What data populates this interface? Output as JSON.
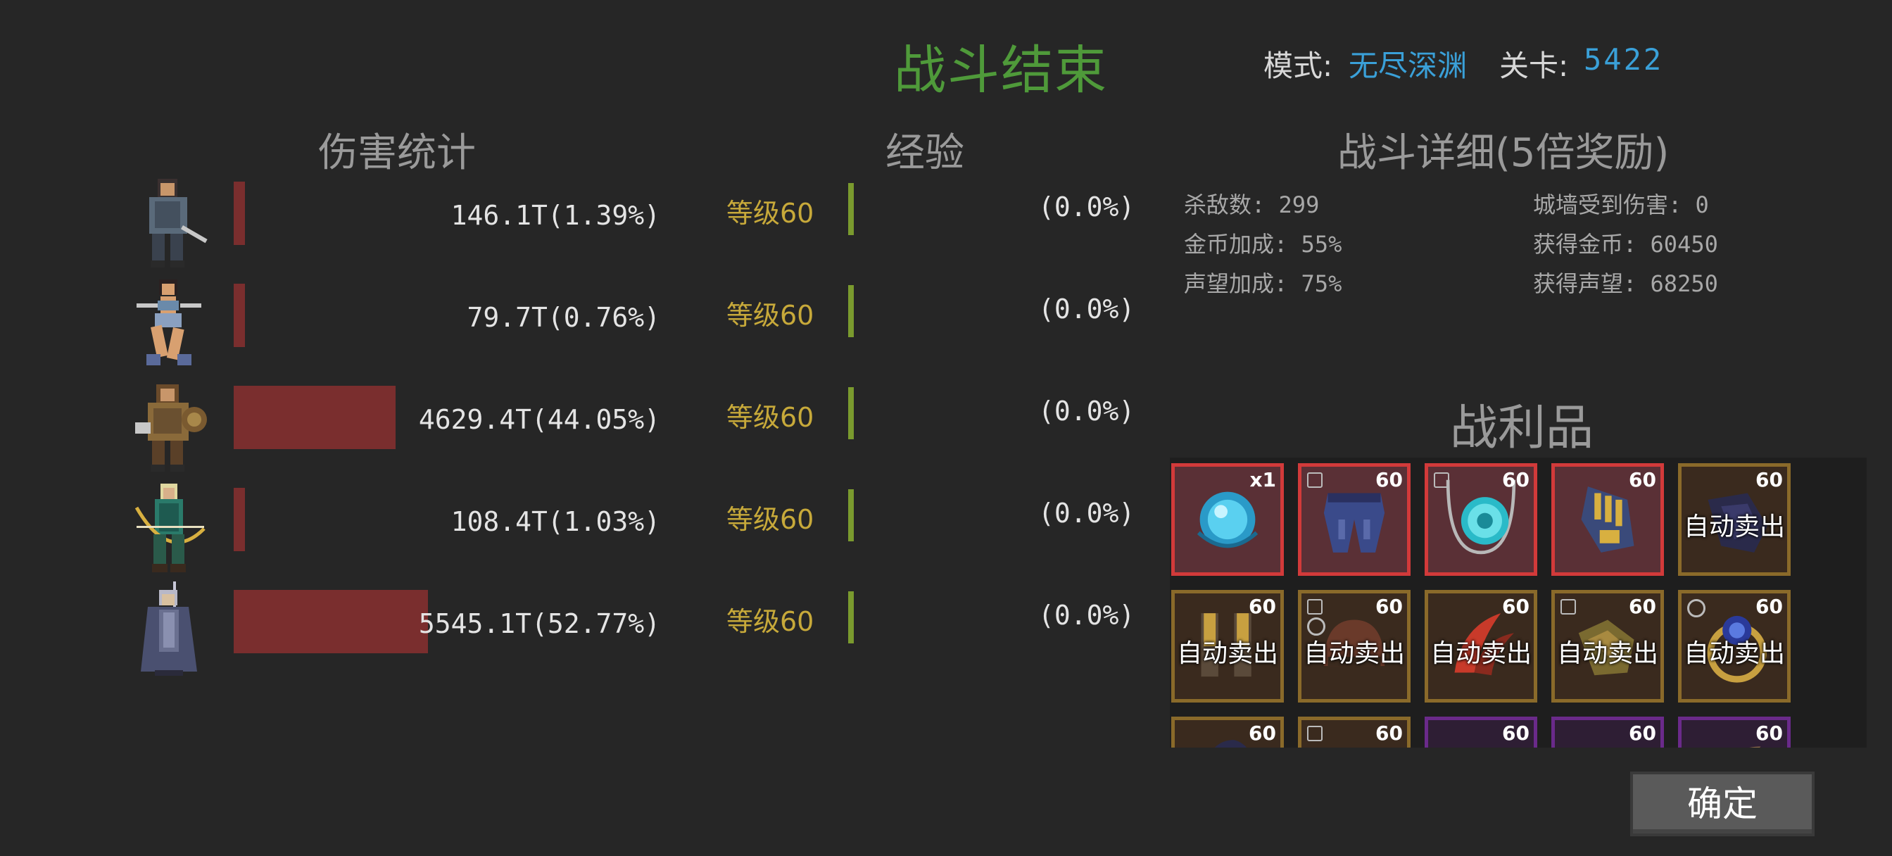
{
  "header": {
    "title": "战斗结束",
    "mode_label": "模式:",
    "mode_value": "无尽深渊",
    "stage_label": "关卡:",
    "stage_value": "5422"
  },
  "damage": {
    "title": "伤害统计",
    "rows": [
      {
        "hero": "swordsman-hero",
        "value": "146.1T(1.39%)",
        "share": 0.0139
      },
      {
        "hero": "dancer-hero",
        "value": "79.7T(0.76%)",
        "share": 0.0076
      },
      {
        "hero": "warrior-hero",
        "value": "4629.4T(44.05%)",
        "share": 0.4405
      },
      {
        "hero": "archer-hero",
        "value": "108.4T(1.03%)",
        "share": 0.0103
      },
      {
        "hero": "mage-hero",
        "value": "5545.1T(52.77%)",
        "share": 0.5277
      }
    ]
  },
  "experience": {
    "title": "经验",
    "rows": [
      {
        "level": "等级60",
        "value": "(0.0%)"
      },
      {
        "level": "等级60",
        "value": "(0.0%)"
      },
      {
        "level": "等级60",
        "value": "(0.0%)"
      },
      {
        "level": "等级60",
        "value": "(0.0%)"
      },
      {
        "level": "等级60",
        "value": "(0.0%)"
      }
    ]
  },
  "details": {
    "title": "战斗详细(5倍奖励)",
    "kills": "杀敌数: 299",
    "wall_damage": "城墙受到伤害: 0",
    "gold_bonus": "金币加成: 55%",
    "gold_gained": "获得金币: 60450",
    "fame_bonus": "声望加成: 75%",
    "fame_gained": "获得声望: 68250"
  },
  "loot": {
    "title": "战利品",
    "auto_sell": "自动卖出",
    "items": [
      {
        "icon": "blue-orb-icon",
        "rarity": "red",
        "badge": "x1",
        "auto": false,
        "lock": false,
        "ring": false
      },
      {
        "icon": "pants-icon",
        "rarity": "red",
        "badge": "60",
        "auto": false,
        "lock": true,
        "ring": false
      },
      {
        "icon": "amulet-icon",
        "rarity": "red",
        "badge": "60",
        "auto": false,
        "lock": true,
        "ring": false
      },
      {
        "icon": "gauntlet-icon",
        "rarity": "red",
        "badge": "60",
        "auto": false,
        "lock": false,
        "ring": false
      },
      {
        "icon": "dark-gloves-icon",
        "rarity": "gold",
        "badge": "60",
        "auto": true,
        "lock": false,
        "ring": false
      },
      {
        "icon": "boots-icon",
        "rarity": "gold",
        "badge": "60",
        "auto": true,
        "lock": false,
        "ring": false
      },
      {
        "icon": "helmet-icon",
        "rarity": "gold",
        "badge": "60",
        "auto": true,
        "lock": true,
        "ring": true
      },
      {
        "icon": "claw-icon",
        "rarity": "gold",
        "badge": "60",
        "auto": true,
        "lock": false,
        "ring": false
      },
      {
        "icon": "gloves-icon",
        "rarity": "gold",
        "badge": "60",
        "auto": true,
        "lock": true,
        "ring": false
      },
      {
        "icon": "ring-icon",
        "rarity": "gold",
        "badge": "60",
        "auto": true,
        "lock": false,
        "ring": true
      },
      {
        "icon": "hood-icon",
        "rarity": "gold",
        "badge": "60",
        "auto": false,
        "lock": false,
        "ring": false
      },
      {
        "icon": "bracer-icon",
        "rarity": "gold",
        "badge": "60",
        "auto": false,
        "lock": true,
        "ring": false
      },
      {
        "icon": "red-charm-icon",
        "rarity": "purple",
        "badge": "60",
        "auto": false,
        "lock": false,
        "ring": false
      },
      {
        "icon": "dark-charm-icon",
        "rarity": "purple",
        "badge": "60",
        "auto": false,
        "lock": false,
        "ring": false
      },
      {
        "icon": "horn-icon",
        "rarity": "purple",
        "badge": "60",
        "auto": false,
        "lock": false,
        "ring": false
      }
    ]
  },
  "confirm_label": "确定",
  "colors": {
    "title_green": "#4f9a3a",
    "blue_value": "#3aa0d8",
    "damage_bar": "#7a2e2e",
    "level_gold": "#c7a93a",
    "exp_bar": "#7a9a2e"
  }
}
